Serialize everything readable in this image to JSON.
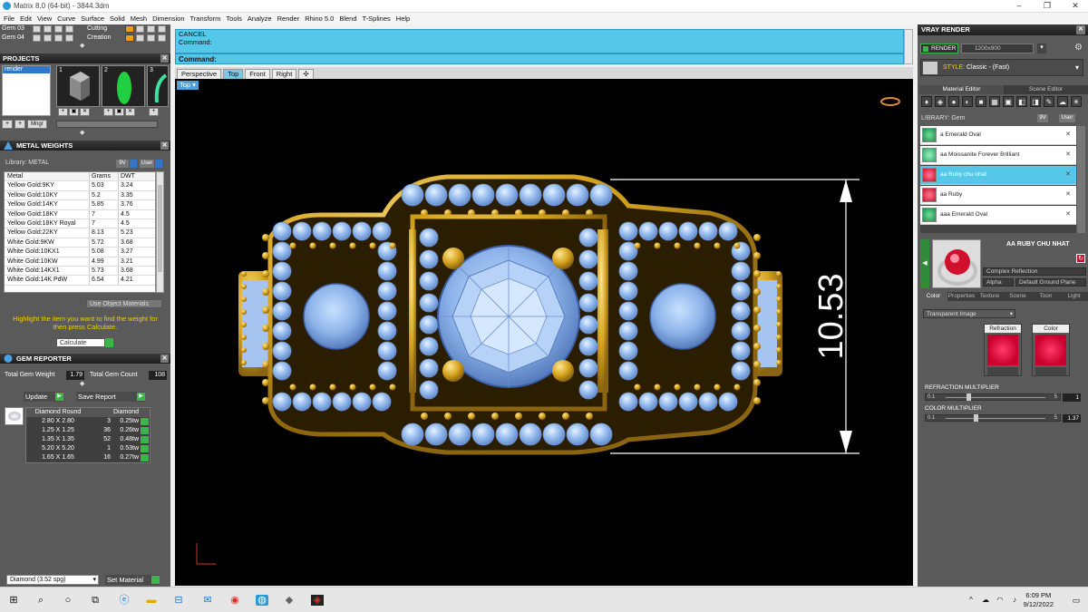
{
  "window": {
    "title": "Matrix 8.0 (64-bit) - 3844.3dm"
  },
  "menu": [
    "File",
    "Edit",
    "View",
    "Curve",
    "Surface",
    "Solid",
    "Mesh",
    "Dimension",
    "Transform",
    "Tools",
    "Analyze",
    "Render",
    "Rhino 5.0",
    "Blend",
    "T-Splines",
    "Help"
  ],
  "layers": [
    {
      "name": "Gem 03",
      "name2": "Cutting",
      "color": "#f39c12"
    },
    {
      "name": "Gem 04",
      "name2": "Creation",
      "color": "#f39c12"
    }
  ],
  "projects": {
    "title": "PROJECTS",
    "items": [
      "render"
    ],
    "thumb_numbers": [
      "1",
      "2",
      "3"
    ],
    "buttons": [
      "+",
      "+",
      "Mngr"
    ]
  },
  "metal_weights": {
    "title": "METAL WEIGHTS",
    "library_label": "Library: METAL",
    "lib_buttons": [
      "9V",
      "User"
    ],
    "columns": [
      "Metal",
      "Grams",
      "DWT"
    ],
    "rows": [
      [
        "Yellow Gold:9KY",
        "5.03",
        "3.24"
      ],
      [
        "Yellow Gold:10KY",
        "5.2",
        "3.35"
      ],
      [
        "Yellow Gold:14KY",
        "5.85",
        "3.76"
      ],
      [
        "Yellow Gold:18KY",
        "7",
        "4.5"
      ],
      [
        "Yellow Gold:18KY Royal",
        "7",
        "4.5"
      ],
      [
        "Yellow Gold:22KY",
        "8.13",
        "5.23"
      ],
      [
        "White Gold:9KW",
        "5.72",
        "3.68"
      ],
      [
        "White Gold:10KX1",
        "5.08",
        "3.27"
      ],
      [
        "White Gold:10KW",
        "4.99",
        "3.21"
      ],
      [
        "White Gold:14KX1",
        "5.73",
        "3.68"
      ],
      [
        "White Gold:14K PdW",
        "6.54",
        "4.21"
      ]
    ],
    "use_object_materials": "Use Object Materials",
    "hint": "Highlight the item you want to find the weight for then press Calculate.",
    "calculate": "Calculate"
  },
  "gem_reporter": {
    "title": "GEM REPORTER",
    "total_weight_label": "Total Gem Weight",
    "total_weight": "1.79",
    "total_count_label": "Total Gem Count",
    "total_count": "108",
    "update": "Update",
    "save_report": "Save Report",
    "columns": [
      "Diamond Round",
      "",
      "Diamond"
    ],
    "rows": [
      [
        "2.80 X 2.80",
        "3",
        "0.25tw"
      ],
      [
        "1.25 X 1.25",
        "36",
        "0.26tw"
      ],
      [
        "1.35 X 1.35",
        "52",
        "0.48tw"
      ],
      [
        "5.20 X 5.20",
        "1",
        "0.53tw"
      ],
      [
        "1.65 X 1.65",
        "16",
        "0.27tw"
      ]
    ],
    "material_select": "Diamond     (3.52 spg)",
    "set_material": "Set Material"
  },
  "command": {
    "history": [
      "CANCEL",
      "Command:"
    ],
    "prompt": "Command:"
  },
  "viewport": {
    "tabs": [
      "Perspective",
      "Top",
      "Front",
      "Right"
    ],
    "active_tab": "Top",
    "label": "Top",
    "dimension": "10.53"
  },
  "vray": {
    "title": "VRAY RENDER",
    "render": "RENDER",
    "resolution": "1200x900",
    "style_label": "STYLE:",
    "style_value": "Classic - (Fast)",
    "tabs": [
      "Material Editor",
      "Scene Editor"
    ],
    "library_label": "LIBRARY: Gem",
    "lib_buttons": [
      "9V",
      "User"
    ],
    "materials": [
      {
        "name": "a Emerald Oval",
        "color": "#1e8a4a",
        "selected": false
      },
      {
        "name": "aa Moissanite Forever Brilliant",
        "color": "#2aa860",
        "selected": false
      },
      {
        "name": "aa Ruby chu nhat",
        "color": "#c8102e",
        "selected": true
      },
      {
        "name": "aa Ruby",
        "color": "#c8102e",
        "selected": false
      },
      {
        "name": "aaa Emerald Oval",
        "color": "#1e8a4a",
        "selected": false
      }
    ],
    "preview_name": "AA RUBY CHU NHAT",
    "complex": "Complex Reflection",
    "alpha": "Alpha",
    "ground": "Default Ground Plane",
    "prop_tabs": [
      "Color",
      "Properties",
      "Texture",
      "Scene",
      "Toon",
      "Light"
    ],
    "transparent": "Transparent Image",
    "swatches": [
      "Refraction",
      "Color"
    ],
    "refraction_label": "REFRACTION MULTIPLIER",
    "refraction_min": "0.1",
    "refraction_max": "5",
    "refraction_value": "1",
    "color_label": "COLOR MULTIPLIER",
    "color_min": "0.1",
    "color_max": "5",
    "color_value": "1.37"
  },
  "taskbar": {
    "time": "6:09 PM",
    "date": "9/12/2022"
  }
}
